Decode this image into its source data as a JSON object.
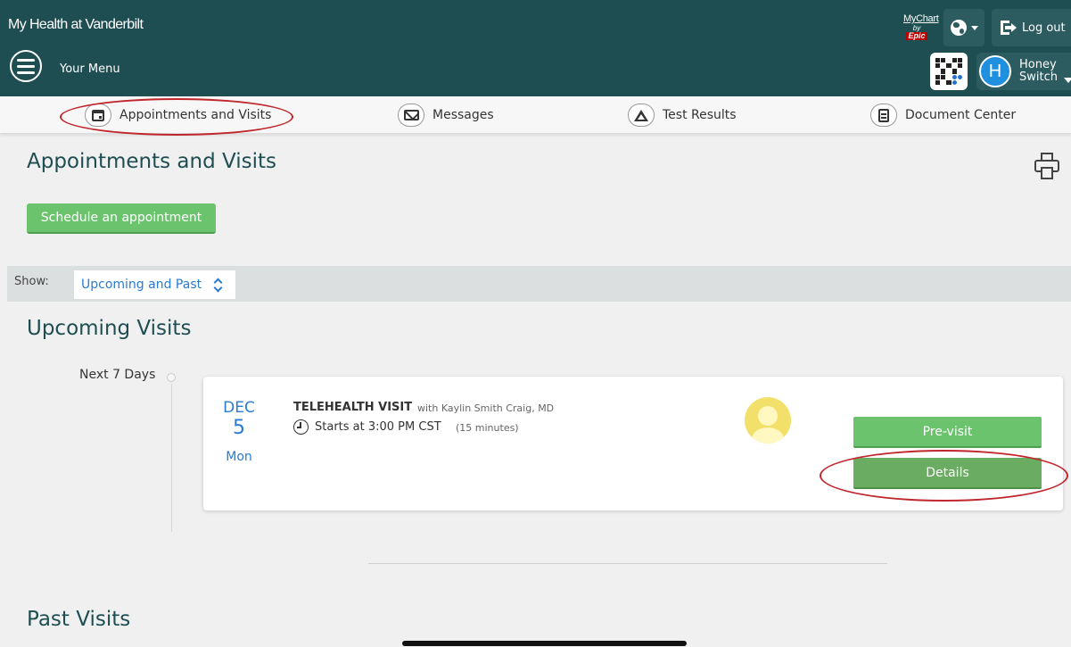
{
  "header": {
    "brand": "My Health at Vanderbilt",
    "menu_label": "Your Menu",
    "logo_line1": "MyChart",
    "logo_by": "by",
    "logo_line2": "Epic",
    "logout_label": "Log out",
    "user_initial": "H",
    "user_name_line1": "Honey",
    "user_name_line2": "Switch"
  },
  "tabs": [
    {
      "label": "Appointments and Visits",
      "icon": "calendar-icon"
    },
    {
      "label": "Messages",
      "icon": "envelope-icon"
    },
    {
      "label": "Test Results",
      "icon": "flask-icon"
    },
    {
      "label": "Document Center",
      "icon": "document-icon"
    }
  ],
  "main": {
    "title": "Appointments and Visits",
    "schedule_label": "Schedule an appointment",
    "show_label": "Show:",
    "show_value": "Upcoming and Past",
    "upcoming_title": "Upcoming Visits",
    "past_title": "Past Visits",
    "timeline_label": "Next 7 Days"
  },
  "visit": {
    "month": "DEC",
    "day": "5",
    "weekday": "Mon",
    "type": "TELEHEALTH VISIT",
    "provider": "with Kaylin Smith Craig, MD",
    "time": "Starts at 3:00 PM CST",
    "duration": "(15 minutes)",
    "previsit_label": "Pre-visit",
    "details_label": "Details"
  },
  "colors": {
    "header_bg": "#1e4e52",
    "accent_green": "#6cc36e",
    "link_blue": "#2a7bd1",
    "annotation_red": "#c0272d"
  }
}
